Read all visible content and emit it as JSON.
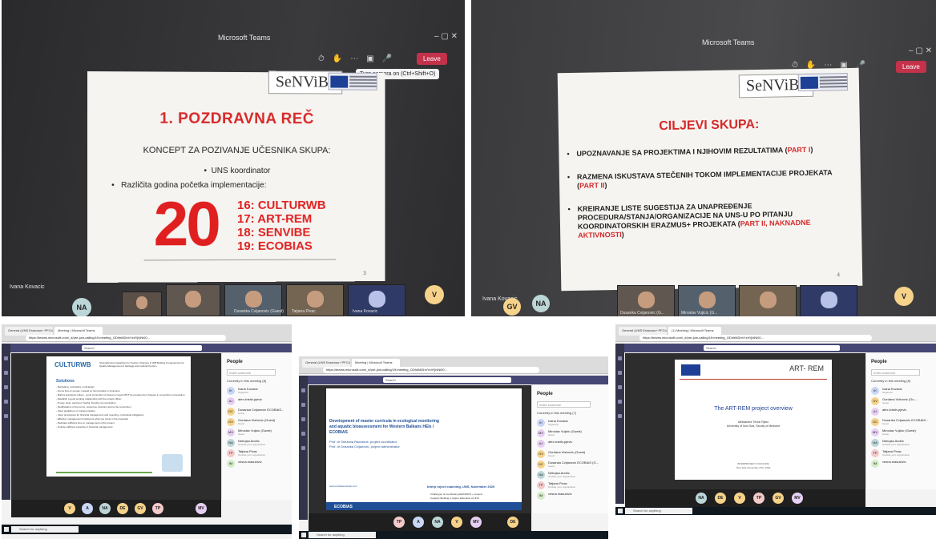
{
  "photo_1": {
    "window_title": "Microsoft Teams",
    "leave_label": "Leave",
    "tooltip": "Turn camera on (Ctrl+Shift+O)",
    "slide": {
      "logo": "SeNViBe",
      "title": "1. POZDRAVNA REČ",
      "subtitle": "KONCEPT ZA POZIVANJE UČESNIKA SKUPA:",
      "bullet_1": "UNS koordinator",
      "bullet_2": "Različita godina početka implementacije:",
      "big_year": "20",
      "projects": [
        "16: CULTURWB",
        "17: ART-REM",
        "18: SENVIBE",
        "19: ECOBIAS"
      ],
      "page_number": "3"
    },
    "presenter_label": "Ivana Kovacic",
    "participant_avatar": "NA",
    "participant_avatar_right": "V",
    "thumb_labels": [
      "Dusanka Cvijanovic (Guest)",
      "Tatjana Pivac",
      "Ivana Kovacic"
    ]
  },
  "photo_2": {
    "window_title": "Microsoft Teams",
    "leave_label": "Leave",
    "slide": {
      "logo": "SeNViBe",
      "title": "CILJEVI SKUPA:",
      "items": [
        {
          "text": "UPOZNAVANJE SA PROJEKTIMA I NJIHOVIM REZULTATIMA (",
          "part": "PART I",
          "tail": ")"
        },
        {
          "text": "RAZMENA ISKUSTAVA STEČENIH TOKOM IMPLEMENTACIJE PROJEKATA (",
          "part": "PART II",
          "tail": ")"
        },
        {
          "text": "KREIRANJE LISTE SUGESTIJA ZA UNAPREĐENJE PROCEDURA/STANJA/ORGANIZACIJE NA UNS-U PO PITANJU KOORDINATORSKIH ERAZMUS+ PROJEKATA (",
          "part": "PART II, NAKNADNE AKTIVNOSTI",
          "tail": ")"
        }
      ],
      "page_number": "4"
    },
    "presenter_label": "Ivana Kovacic",
    "avatars": [
      "GV",
      "NA",
      "V"
    ],
    "thumb_labels": [
      "Dusanka Cvijanovic (G...",
      "Miroslav Vujicic (G..."
    ]
  },
  "screen_3": {
    "tabs": [
      "General (UNS Erasmus+ PFCU)",
      "Meeting | Microsoft Teams"
    ],
    "url": "https://teams.microsoft.com/_#/pre-join-calling/19:meeting_ODhhMDhhYzItYjhlNi00...",
    "search": "Search",
    "slide": {
      "logo": "CULTURWB",
      "header": "Strengthening Capacities for Tourism Changes in WB Building Competences for Quality Management of Heritage and Cultural Tourism",
      "section": "Solutions",
      "bullets": [
        "Motivating, motivating, motivating!!",
        "Focus first on people, instead on formal tasks or structures",
        "Build a teamwork culture - good consortium is based on teams BUT be prepared for changes in consortium composition",
        "Establish a good working relationship with the project officer",
        "Timely, clear, pertinent, helpful, friendly communication",
        "Modifications of the terms, resources, diversity across the consortium",
        "Clear guidelines on implementation",
        "Clear procedures for financial management and reporting, contractual obligations",
        "Effective management (implement what you wrote in the proposal)",
        "Dedicate sufficient time to management of the project",
        "Include sufficient expertise in financial management"
      ]
    },
    "people": {
      "title": "People",
      "invite": "Invite someone",
      "in_meeting": "Currently in this meeting (8)",
      "mute_all": "Mute all",
      "list": [
        {
          "initials": "IK",
          "name": "Ivana Kovacic",
          "role": "Organizer"
        },
        {
          "initials": "AJ",
          "name": "alex.kristin.pjevic",
          "role": ""
        },
        {
          "initials": "DC",
          "name": "Dusanka Cvijanovic ECOBIAS...",
          "role": "Guest"
        },
        {
          "initials": "GV",
          "name": "Gordana Vlahovic (Guest)",
          "role": "Guest"
        },
        {
          "initials": "MV",
          "name": "Miroslav Vujicic (Guest)",
          "role": "Guest"
        },
        {
          "initials": "NA",
          "name": "Nebojsa Andric",
          "role": "Outside your organization"
        },
        {
          "initials": "TP",
          "name": "Tatjana Pivac",
          "role": "Outside your organization"
        },
        {
          "initials": "IM",
          "name": "vesna.masulovic",
          "role": ""
        }
      ]
    },
    "call_avatars": [
      "V",
      "A",
      "NA",
      "DE",
      "GV",
      "TP",
      "MV"
    ],
    "taskbar_search": "Search for anything"
  },
  "screen_4": {
    "tabs": [
      "General (UNS Erasmus+ PFCU)",
      "Meeting | Microsoft Teams"
    ],
    "url": "https://teams.microsoft.com/_#/pre-join-calling/19:meeting_ODhhMDhhYzItYjhlNi00...",
    "search": "Search",
    "slide": {
      "title": "Development of master curricula in ecological monitoring and aquatic bioassessment for Western Balkans HEIs / ECOBIAS",
      "line_1": "Prof. dr Snežana Radulović, project coordinator",
      "line_2": "Prof. dr Dušanka Cvijanović, project administrator",
      "website": "www.ecobiasnetwork.com",
      "event": "Interp roject coaching, UNS, November 2020",
      "subtitle": "Challenges of coordinating ERASMUS + projects",
      "subtitle_2": "Capacity Building in Higher Education at UNS",
      "logo": "ECOBIAS"
    },
    "people": {
      "title": "People",
      "invite": "Invite someone",
      "in_meeting": "Currently in this meeting (7)",
      "list": [
        {
          "initials": "IK",
          "name": "Ivana Kovacic",
          "role": "Organizer"
        },
        {
          "initials": "MV",
          "name": "Miroslav Vujicic (Guest)",
          "role": "Guest"
        },
        {
          "initials": "AJ",
          "name": "alex.kristin.pjevic",
          "role": ""
        },
        {
          "initials": "GV",
          "name": "Gordana Vlahovic (Guest)",
          "role": "Guest"
        },
        {
          "initials": "DC",
          "name": "Dusanka Cvijanovic ECOBIAS (G...",
          "role": "Guest"
        },
        {
          "initials": "NA",
          "name": "Nebojsa Andric",
          "role": "Outside your organization"
        },
        {
          "initials": "TP",
          "name": "Tatjana Pivac",
          "role": "Outside your organization"
        },
        {
          "initials": "IM",
          "name": "vesna.masulovic",
          "role": ""
        }
      ]
    },
    "call_avatars": [
      "TP",
      "A",
      "NA",
      "V",
      "MV",
      "DE"
    ],
    "taskbar_search": "Search for anything"
  },
  "screen_5": {
    "tabs": [
      "General (UNS Erasmus+ PFCU)",
      "(1) Meeting | Microsoft Teams"
    ],
    "url": "https://teams.microsoft.com/_#/pre-join-calling/19:meeting_ODhhMDhhYzItYjhlNi00...",
    "search": "Search",
    "slide": {
      "logo": "ART- REM",
      "title": "The ART-REM project overview",
      "author": "Aleksandra Trivkic Rjeko",
      "affiliation": "University of Novi Sad, Faculty of Medicine",
      "event": "INTERPROJECT COACHING",
      "date": "Novi Sad, November 27th, 2020"
    },
    "people": {
      "title": "People",
      "invite": "Invite someone",
      "in_meeting": "Currently in this meeting (8)",
      "list": [
        {
          "initials": "IK",
          "name": "Ivana Kovacic",
          "role": "Organizer"
        },
        {
          "initials": "GV",
          "name": "Gordana Vlahovic (Gu...",
          "role": "Guest"
        },
        {
          "initials": "AJ",
          "name": "alex.kristin.pjevic",
          "role": ""
        },
        {
          "initials": "DC",
          "name": "Dusanka Cvijanovic ECOBIAS...",
          "role": "Guest"
        },
        {
          "initials": "MV",
          "name": "Miroslav Vujicic (Guest)",
          "role": "Guest"
        },
        {
          "initials": "NA",
          "name": "Nebojsa Andric",
          "role": "Outside your organization"
        },
        {
          "initials": "TP",
          "name": "Tatjana Pivac",
          "role": "Outside your organization"
        },
        {
          "initials": "IM",
          "name": "vesna.masulovic",
          "role": ""
        }
      ]
    },
    "call_avatars": [
      "NA",
      "DE",
      "V",
      "TP",
      "GV",
      "MV"
    ],
    "taskbar_search": "Search for anything"
  },
  "colors": {
    "teams_purple": "#464775",
    "leave_red": "#c4314b",
    "slide_red": "#e02020",
    "avatar_palette": [
      "#f6d28a",
      "#c9d7f5",
      "#f3c9c9",
      "#d4ecc7",
      "#e7d0f3"
    ]
  }
}
